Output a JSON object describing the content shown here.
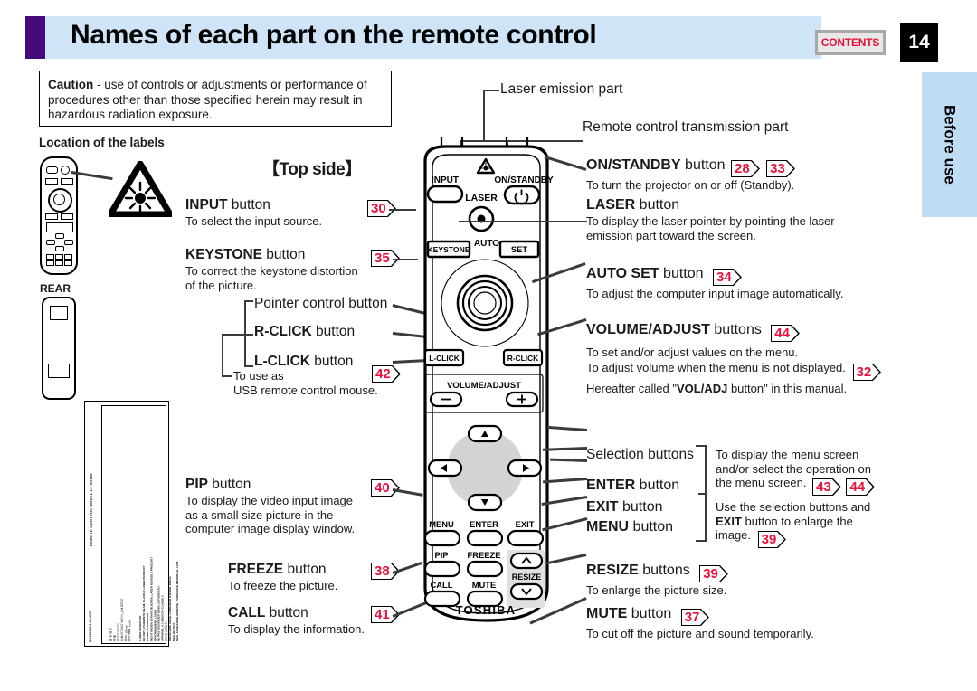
{
  "header": {
    "title": "Names of each part on the remote control",
    "contents_label": "CONTENTS",
    "page_number": "14",
    "side_tab": "Before use"
  },
  "caution": {
    "bold": "Caution",
    "text": " - use of controls or adjustments or performance of procedures other than those specified herein may result in hazardous radiation exposure.",
    "location_heading": "Location of the labels",
    "rear_label": "REAR"
  },
  "warning_label": {
    "english": "LASER RADIATION\nDO NOT STARE INTO BEAM, CLASS 2 LASER PRODUCT\nLASER-STRAHLUNG\nNICHT IN DEN STRAHL BLICKEN, LASER KLASSE 2 PRODUKT\nRAYONNEMENT LASER\nNE PAS REGARDER DANS LE FAISCEAU\nAPPAREIL A LASER DE CLASSE 2\nWAVE LENGTH\nOSCILLEMA ANGE, LONGUEUR D'ONDE: 650nm\nMAX OUTPUT\nMAX. AUSGANGSLEISTUNG, PUISSANCE MAXIMALE: 1mW",
    "cjk": "最 大 出 力\n波 長\n레이저 방사선\n빔을 직시하지 마시오, 2 급 레이저\n파장 : 650nm\n최대 출력 : 1mW",
    "meta": "REMOTE CONTROL     MODEL CT-90106",
    "code": "BD046625-1 A1-1997"
  },
  "topside_heading": "【Top side】",
  "callouts": {
    "laser_emission": "Laser emission part",
    "transmission": "Remote control transmission part"
  },
  "left_items": [
    {
      "name": "INPUT",
      "suffix": " button",
      "desc": "To select the input source.",
      "badges": [
        "30"
      ]
    },
    {
      "name": "KEYSTONE",
      "suffix": " button",
      "desc": "To correct the keystone distortion\nof the picture.",
      "badges": [
        "35"
      ]
    },
    {
      "name": "PIP",
      "suffix": " button",
      "desc": "To display the video input image\nas a small size picture in the\ncomputer image display window.",
      "badges": [
        "40"
      ]
    },
    {
      "name": "FREEZE",
      "suffix": " button",
      "desc": "To freeze the picture.",
      "badges": [
        "38"
      ]
    },
    {
      "name": "CALL",
      "suffix": " button",
      "desc": "To display the information.",
      "badges": [
        "41"
      ]
    }
  ],
  "pointer_group": {
    "pointer": "Pointer control button",
    "rclick_name": "R-CLICK",
    "rclick_suffix": " button",
    "lclick_name": "L-CLICK",
    "lclick_suffix": " button",
    "note_line1": "To use as",
    "note_line2": "USB remote control mouse.",
    "note_badge": "42"
  },
  "right_items": [
    {
      "name": "ON/STANDBY",
      "suffix": " button",
      "desc": "To turn the projector on or off (Standby).",
      "badges": [
        "28",
        "33"
      ]
    },
    {
      "name": "LASER",
      "suffix": " button",
      "desc": "To display the laser pointer by pointing the laser\nemission part toward the screen.",
      "badges": []
    },
    {
      "name": "AUTO SET",
      "suffix": " button",
      "desc": "To adjust the computer input image automatically.",
      "badges": [
        "34"
      ]
    }
  ],
  "volume_item": {
    "name": "VOLUME/ADJUST",
    "suffix": " buttons",
    "badge": "44",
    "line1": "To set and/or adjust values on the menu.",
    "line2": "To adjust volume when the menu is not displayed.",
    "line2_badge": "32",
    "line3_pre": "Hereafter called \"",
    "line3_bold": "VOL/ADJ",
    "line3_post": " button\" in this manual."
  },
  "selection_group": {
    "selection": "Selection buttons",
    "enter_name": "ENTER",
    "enter_suffix": " button",
    "exit_name": "EXIT",
    "exit_suffix": " button",
    "menu_name": "MENU",
    "menu_suffix": " button",
    "desc1_l1": "To display the menu screen",
    "desc1_l2": "and/or select the operation on",
    "desc1_l3": "the menu screen.",
    "desc1_badges": [
      "43",
      "44"
    ],
    "desc2_l1": "Use the selection buttons and",
    "desc2_bold": "EXIT",
    "desc2_l2": " button to enlarge the",
    "desc2_l3": "image.",
    "desc2_badge": "39"
  },
  "bottom_right_items": [
    {
      "name": "RESIZE",
      "suffix": " buttons",
      "desc": "To enlarge the picture size.",
      "badges": [
        "39"
      ]
    },
    {
      "name": "MUTE",
      "suffix": " button",
      "desc": "To cut off the picture and sound temporarily.",
      "badges": [
        "37"
      ]
    }
  ],
  "remote_buttons": {
    "input": "INPUT",
    "on_standby": "ON/STANDBY",
    "laser": "LASER",
    "keystone": "KEYSTONE",
    "auto": "AUTO",
    "set": "SET",
    "lclick": "L-CLICK",
    "rclick": "R-CLICK",
    "volume_adjust": "VOLUME/ADJUST",
    "minus": "–",
    "plus": "+",
    "menu": "MENU",
    "enter": "ENTER",
    "exit": "EXIT",
    "pip": "PIP",
    "freeze": "FREEZE",
    "call": "CALL",
    "mute": "MUTE",
    "resize": "RESIZE",
    "brand": "TOSHIBA"
  },
  "colors": {
    "accent_purple": "#450b7d",
    "band_blue": "#cfe4f7",
    "tab_blue": "#bfdcf5",
    "badge_red": "#e8123c"
  }
}
